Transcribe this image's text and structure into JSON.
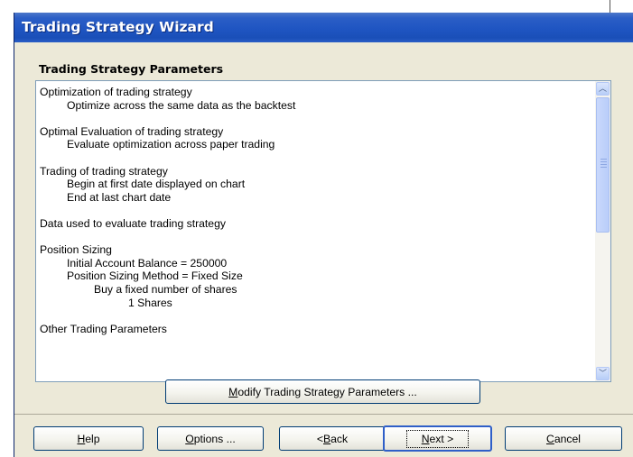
{
  "window": {
    "title": "Trading Strategy Wizard"
  },
  "section": {
    "label": "Trading Strategy Parameters"
  },
  "parameters_text": [
    {
      "text": "Optimization of trading strategy",
      "indent": 0
    },
    {
      "text": "Optimize across the same data as the backtest",
      "indent": 1
    },
    {
      "text": "",
      "indent": 0
    },
    {
      "text": "Optimal Evaluation of trading strategy",
      "indent": 0
    },
    {
      "text": "Evaluate optimization across paper trading",
      "indent": 1
    },
    {
      "text": "",
      "indent": 0
    },
    {
      "text": "Trading of trading strategy",
      "indent": 0
    },
    {
      "text": "Begin at first date displayed on chart",
      "indent": 1
    },
    {
      "text": "End at last chart date",
      "indent": 1
    },
    {
      "text": "",
      "indent": 0
    },
    {
      "text": "Data used to evaluate trading strategy",
      "indent": 0
    },
    {
      "text": "",
      "indent": 0
    },
    {
      "text": "Position Sizing",
      "indent": 0
    },
    {
      "text": "Initial Account Balance = 250000",
      "indent": 1
    },
    {
      "text": "Position Sizing Method = Fixed Size",
      "indent": 1
    },
    {
      "text": "Buy a fixed number of shares",
      "indent": 2
    },
    {
      "text": "1 Shares",
      "indent": 3
    },
    {
      "text": "",
      "indent": 0
    },
    {
      "text": "Other Trading Parameters",
      "indent": 0
    }
  ],
  "scrollbar": {
    "up_icon": "chevron-up-icon",
    "down_icon": "chevron-down-icon",
    "up_glyph": "︿",
    "down_glyph": "﹀"
  },
  "buttons": {
    "modify": {
      "pre": "",
      "mnemonic": "M",
      "post": "odify Trading Strategy Parameters ..."
    },
    "help": {
      "pre": "",
      "mnemonic": "H",
      "post": "elp"
    },
    "options": {
      "pre": "",
      "mnemonic": "O",
      "post": "ptions ..."
    },
    "back": {
      "pre": "< ",
      "mnemonic": "B",
      "post": "ack"
    },
    "next": {
      "pre": "",
      "mnemonic": "N",
      "post": "ext >"
    },
    "cancel": {
      "pre": "",
      "mnemonic": "C",
      "post": "ancel"
    }
  },
  "colors": {
    "titlebar": "#1f55c2",
    "dialog_background": "#ece9d8",
    "button_border": "#003c74",
    "default_button_border": "#2f5fc8"
  }
}
